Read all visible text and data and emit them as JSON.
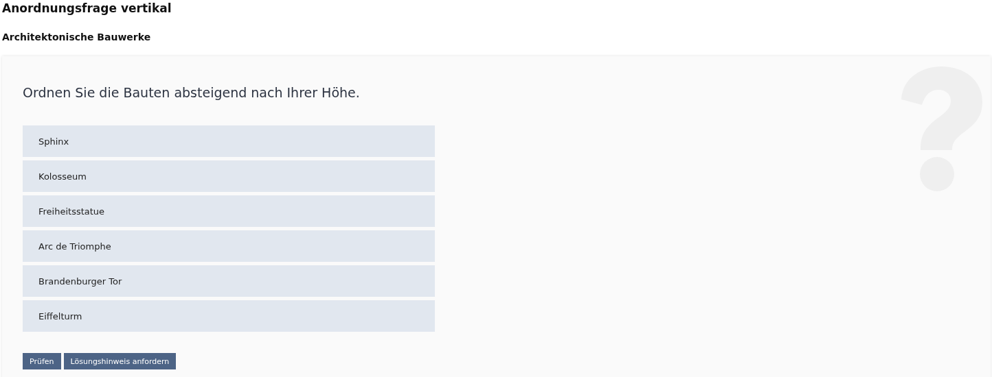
{
  "title": "Anordnungsfrage vertikal",
  "subtitle": "Architektonische Bauwerke",
  "question": "Ordnen Sie die Bauten absteigend nach Ihrer Höhe.",
  "items": [
    "Sphinx",
    "Kolosseum",
    "Freiheitsstatue",
    "Arc de Triomphe",
    "Brandenburger Tor",
    "Eiffelturm"
  ],
  "buttons": [
    "Prüfen",
    "Lösungshinweis anfordern"
  ]
}
